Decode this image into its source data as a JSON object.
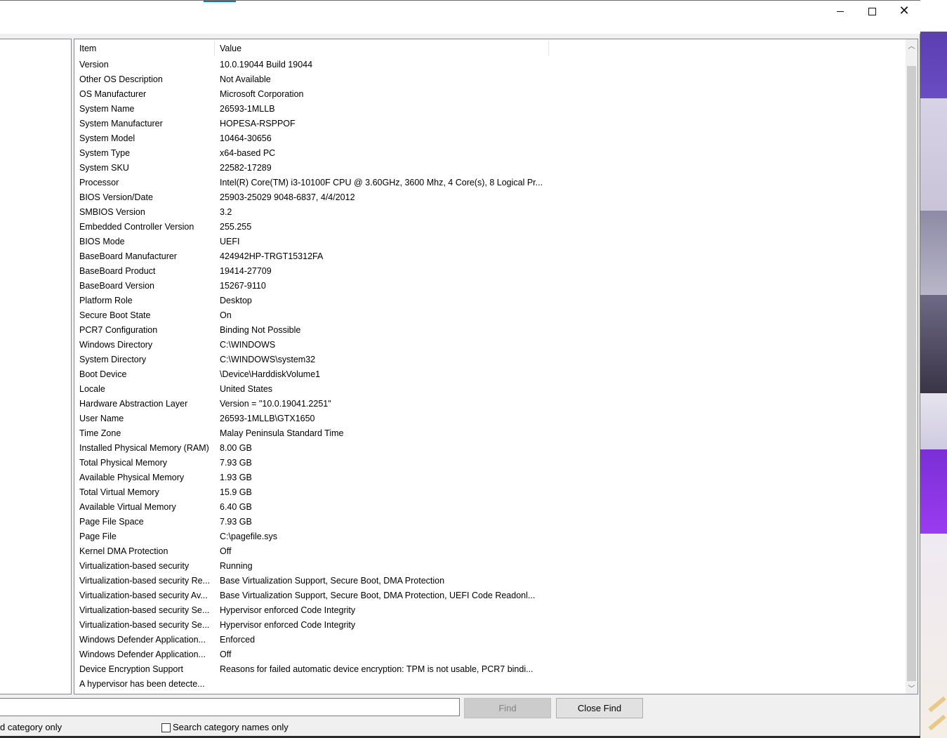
{
  "window": {
    "controls": {
      "minimize": "minimize",
      "maximize": "maximize",
      "close": "close"
    }
  },
  "list": {
    "columns": {
      "item": "Item",
      "value": "Value"
    },
    "rows": [
      {
        "item": "Version",
        "value": "10.0.19044 Build 19044"
      },
      {
        "item": "Other OS Description",
        "value": "Not Available"
      },
      {
        "item": "OS Manufacturer",
        "value": "Microsoft Corporation"
      },
      {
        "item": "System Name",
        "value": "26593-1MLLB"
      },
      {
        "item": "System Manufacturer",
        "value": "HOPESA-RSPPOF"
      },
      {
        "item": "System Model",
        "value": "10464-30656"
      },
      {
        "item": "System Type",
        "value": "x64-based PC"
      },
      {
        "item": "System SKU",
        "value": "22582-17289"
      },
      {
        "item": "Processor",
        "value": "Intel(R) Core(TM) i3-10100F CPU @ 3.60GHz, 3600 Mhz, 4 Core(s), 8 Logical Pr..."
      },
      {
        "item": "BIOS Version/Date",
        "value": "25903-25029 9048-6837, 4/4/2012"
      },
      {
        "item": "SMBIOS Version",
        "value": "3.2"
      },
      {
        "item": "Embedded Controller Version",
        "value": "255.255"
      },
      {
        "item": "BIOS Mode",
        "value": "UEFI"
      },
      {
        "item": "BaseBoard Manufacturer",
        "value": "424942HP-TRGT15312FA"
      },
      {
        "item": "BaseBoard Product",
        "value": "19414-27709"
      },
      {
        "item": "BaseBoard Version",
        "value": "15267-9110"
      },
      {
        "item": "Platform Role",
        "value": "Desktop"
      },
      {
        "item": "Secure Boot State",
        "value": "On"
      },
      {
        "item": "PCR7 Configuration",
        "value": "Binding Not Possible"
      },
      {
        "item": "Windows Directory",
        "value": "C:\\WINDOWS"
      },
      {
        "item": "System Directory",
        "value": "C:\\WINDOWS\\system32"
      },
      {
        "item": "Boot Device",
        "value": "\\Device\\HarddiskVolume1"
      },
      {
        "item": "Locale",
        "value": "United States"
      },
      {
        "item": "Hardware Abstraction Layer",
        "value": "Version = \"10.0.19041.2251\""
      },
      {
        "item": "User Name",
        "value": "26593-1MLLB\\GTX1650"
      },
      {
        "item": "Time Zone",
        "value": "Malay Peninsula Standard Time"
      },
      {
        "item": "Installed Physical Memory (RAM)",
        "value": "8.00 GB"
      },
      {
        "item": "Total Physical Memory",
        "value": "7.93 GB"
      },
      {
        "item": "Available Physical Memory",
        "value": "1.93 GB"
      },
      {
        "item": "Total Virtual Memory",
        "value": "15.9 GB"
      },
      {
        "item": "Available Virtual Memory",
        "value": "6.40 GB"
      },
      {
        "item": "Page File Space",
        "value": "7.93 GB"
      },
      {
        "item": "Page File",
        "value": "C:\\pagefile.sys"
      },
      {
        "item": "Kernel DMA Protection",
        "value": "Off"
      },
      {
        "item": "Virtualization-based security",
        "value": "Running"
      },
      {
        "item": "Virtualization-based security Re...",
        "value": "Base Virtualization Support, Secure Boot, DMA Protection"
      },
      {
        "item": "Virtualization-based security Av...",
        "value": "Base Virtualization Support, Secure Boot, DMA Protection, UEFI Code Readonl..."
      },
      {
        "item": "Virtualization-based security Se...",
        "value": "Hypervisor enforced Code Integrity"
      },
      {
        "item": "Virtualization-based security Se...",
        "value": "Hypervisor enforced Code Integrity"
      },
      {
        "item": "Windows Defender Application...",
        "value": "Enforced"
      },
      {
        "item": "Windows Defender Application...",
        "value": "Off"
      },
      {
        "item": "Device Encryption Support",
        "value": "Reasons for failed automatic device encryption: TPM is not usable, PCR7 bindi..."
      },
      {
        "item": "A hypervisor has been detecte...",
        "value": ""
      }
    ]
  },
  "find": {
    "input_value": "",
    "find_label": "Find",
    "close_find_label": "Close Find",
    "option_selected_category": "d category only",
    "option_search_names": "Search category names only"
  },
  "icons": {
    "scroll_up": "chevron-up-icon",
    "scroll_down": "chevron-down-icon"
  }
}
